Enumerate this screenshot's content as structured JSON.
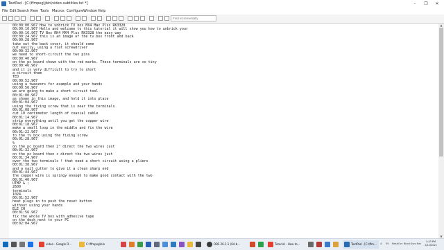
{
  "window": {
    "title": "TextPad - [C:\\ffmpeg\\jbin\\video-subtitles.txt *]",
    "controls": [
      "–",
      "❐",
      "✕"
    ]
  },
  "menu": [
    "File",
    "Edit",
    "Search",
    "View",
    "Tools",
    "Macros",
    "Configure",
    "Window",
    "Help"
  ],
  "find": {
    "placeholder": "Find incrementally"
  },
  "editor": {
    "lines": [
      "00:00:00.967 How to unbrick TV box MX4 Max Plus RK3328",
      "00:00:10.967 Hello and welcome to this tutorial it will show you how to unbrick your",
      "00:00:16.967 TV Box RK4 MX4 Plus RK3328 the easy way",
      "00:00:24.967 this is an image of the tv box front and back",
      "00:00:28.967",
      "take out the back cover, it should come",
      "out easily, using a flat screwdriver",
      "00:00:32.967",
      "we need to short-circuit the two pins",
      "00:00:40.967",
      "on the pc board shown with the red marks. These terminals are so tiny",
      "00:00:46.967",
      "and it is very difficult to try to short",
      "a circuit them",
      "TED",
      "00:00:52.967",
      "using a tweezers for example and your hands",
      "00:00:56.967",
      "we are going to make a short circuit tool",
      "00:01:00.967",
      "as shown in this image, and hold it into place",
      "00:01:04.967",
      "using the fixing screw that is near the terminals",
      "00:01:08.967",
      "cut 10 centimeter length of coaxial cable",
      "00:01:14.967",
      "strip everything until you get the copper wire",
      "00:01:18.967",
      "make a small loop in the middle and fix the wire",
      "00:01:22.967",
      "to the tv box using the fixing screw",
      "00:01:28.967",
      "%",
      "on the pc board then 2\" direct the two wires just",
      "00:01:32.967",
      "on the pc board then c direct the two wires just",
      "00:01:34.967",
      "over the two terminals ! that need a short circuit using a pliers",
      "00:01:38.967",
      "and a nail cutter to give it a clean sharp end",
      "00:01:44.967",
      "the copper wire is springy enough to make good contact with the two",
      "00:01:40.967",
      "UTMP & ;",
      "2600",
      "terminals",
      "1024.",
      "00:01:52.967",
      "heat plugs in to push the reset button",
      "without using your hands",
      "ELE CH",
      "00:01:56.967",
      "fix the whole TV box with adhesive tape",
      "on the desk next to your PC",
      "00:02:04.967"
    ]
  },
  "taskbar": {
    "buttons": [
      {
        "label": "video - Google D...",
        "color": "#e34133"
      },
      {
        "label": "C:\\ffmpeg\\bin",
        "color": "#e8b93a"
      },
      {
        "label": "OBS 26.1.1 (64-b...",
        "color": "#3a3a3a"
      },
      {
        "label": "Tutorial - How to...",
        "color": "#e34133"
      },
      {
        "label": "TextPad - [C:\\ffm...",
        "color": "#2b6cb0"
      }
    ],
    "status": [
      "4",
      "55",
      "Read",
      "Ovr",
      "Block",
      "Sync",
      "Rec"
    ],
    "time": "1:43 PM",
    "date": "1/12/2021"
  },
  "colors": {
    "text": "#1a1a1a",
    "gutter": "#f7f7f7",
    "taskbar": "#e9eef5",
    "accent": "#2b6cb0"
  }
}
